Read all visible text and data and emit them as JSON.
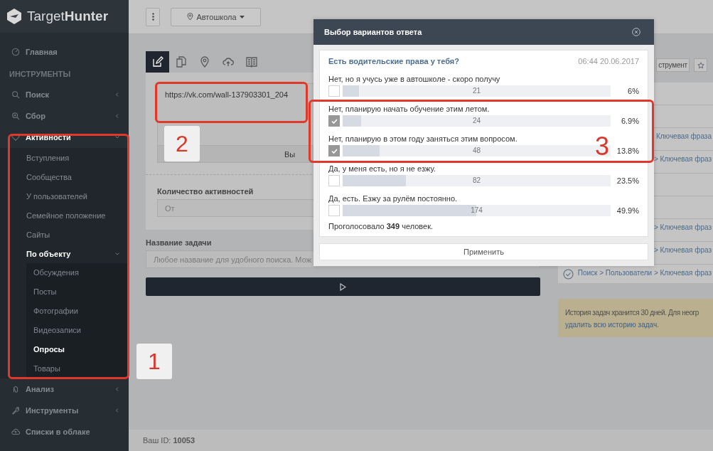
{
  "sidebar": {
    "logo": {
      "prefix": "Target",
      "suffix": "Hunter"
    },
    "items": [
      {
        "kind": "link",
        "label": "Главная",
        "selected": false
      },
      {
        "kind": "section",
        "label": "ИНСТРУМЕНТЫ"
      },
      {
        "kind": "group",
        "label": "Поиск",
        "expanded": false
      },
      {
        "kind": "group",
        "label": "Сбор",
        "expanded": false
      },
      {
        "kind": "group",
        "label": "Активности",
        "expanded": true,
        "children": [
          {
            "kind": "link",
            "label": "Вступления",
            "selected": false
          },
          {
            "kind": "link",
            "label": "Сообщества",
            "selected": false
          },
          {
            "kind": "link",
            "label": "У пользователей",
            "selected": false
          },
          {
            "kind": "link",
            "label": "Семейное положение",
            "selected": false
          },
          {
            "kind": "link",
            "label": "Сайты",
            "selected": false
          },
          {
            "kind": "group",
            "label": "По объекту",
            "expanded": true,
            "children": [
              {
                "kind": "link",
                "label": "Обсуждения",
                "selected": false
              },
              {
                "kind": "link",
                "label": "Посты",
                "selected": false
              },
              {
                "kind": "link",
                "label": "Фотографии",
                "selected": false
              },
              {
                "kind": "link",
                "label": "Видеозаписи",
                "selected": false
              },
              {
                "kind": "link",
                "label": "Опросы",
                "selected": true
              },
              {
                "kind": "link",
                "label": "Товары",
                "selected": false
              }
            ]
          }
        ]
      },
      {
        "kind": "group",
        "label": "Анализ",
        "expanded": false
      },
      {
        "kind": "group",
        "label": "Инструменты",
        "expanded": false
      },
      {
        "kind": "link",
        "label": "Списки в облаке",
        "selected": false
      }
    ]
  },
  "top_bar": {
    "project_button": "Автошкола"
  },
  "source_tabs": [
    {
      "selected": true
    },
    {
      "selected": false
    },
    {
      "selected": false
    },
    {
      "selected": false
    },
    {
      "selected": false
    }
  ],
  "form": {
    "url_value": "https://vk.com/wall-137903301_204",
    "select_button": "Вы",
    "count_label": "Количество активностей",
    "count_placeholder": "От",
    "name_label": "Название задачи",
    "name_placeholder": "Любое название для удобного поиска. Мож"
  },
  "task_history": {
    "tool_button": "струмент",
    "rows": [
      {
        "kind": "partial",
        "text": "Ключевая фраза"
      },
      {
        "kind": "partial",
        "text": "> Ключевая фраз"
      },
      {
        "kind": "partial",
        "text": "> Ключевая фраз"
      },
      {
        "kind": "partial",
        "text": "> Ключевая фраз"
      },
      {
        "kind": "full",
        "text": "Поиск > Пользователи > Ключевая фраз"
      }
    ],
    "notice": {
      "text": "История задач хранится 30 дней. Для неогр",
      "link": "удалить всю историю задач."
    }
  },
  "footer": {
    "user_id": "Ваш ID: **10053**"
  },
  "dialog": {
    "title": "Выбор вариантов ответа",
    "question": "Есть водительские права у тебя?",
    "date": "06:44 20.06.2017",
    "options": [
      {
        "text": "Нет, но я учусь уже в автошколе - скоро получу",
        "checked": false,
        "level": 0.06,
        "votes": "21",
        "percent": "6%"
      },
      {
        "text": "Нет, планирую начать обучение этим летом.",
        "checked": true,
        "level": 0.069,
        "votes": "24",
        "percent": "6.9%"
      },
      {
        "text": "Нет, планирую в этом году заняться этим вопросом.",
        "checked": true,
        "level": 0.138,
        "votes": "48",
        "percent": "13.8%"
      },
      {
        "text": "Да, у меня есть, но я не езжу.",
        "checked": false,
        "level": 0.235,
        "votes": "82",
        "percent": "23.5%"
      },
      {
        "text": "Да, есть. Езжу за рулём постоянно.",
        "checked": false,
        "level": 0.499,
        "votes": "174",
        "percent": "49.9%"
      }
    ],
    "total": "Проголосовало **349** человек.",
    "apply_button": "Применить"
  },
  "annotations": [
    {
      "label": "1"
    },
    {
      "label": "2"
    },
    {
      "label": "3"
    }
  ]
}
